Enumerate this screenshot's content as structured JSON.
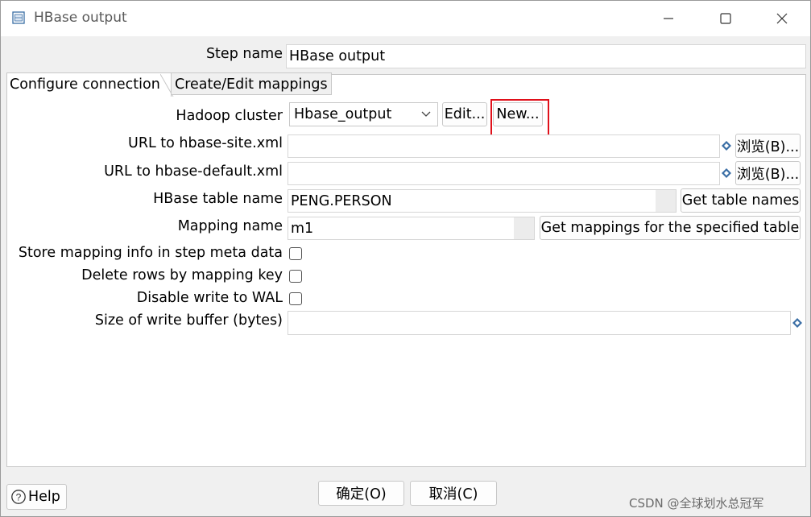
{
  "window": {
    "title": "HBase output",
    "icon": "hbase-step-icon",
    "controls": [
      "minimize-icon",
      "maximize-icon",
      "close-icon"
    ]
  },
  "step": {
    "label": "Step name",
    "value": "HBase output"
  },
  "tabs": [
    {
      "label": "Configure connection",
      "active": true
    },
    {
      "label": "Create/Edit mappings",
      "active": false
    }
  ],
  "connection": {
    "hadoop_cluster": {
      "label": "Hadoop cluster",
      "selected": "Hbase_output",
      "edit_label": "Edit...",
      "new_label": "New..."
    },
    "site_xml": {
      "label": "URL to hbase-site.xml",
      "value": "",
      "browse_label": "浏览(B)..."
    },
    "default_xml": {
      "label": "URL to hbase-default.xml",
      "value": "",
      "browse_label": "浏览(B)..."
    },
    "table_name": {
      "label": "HBase table name",
      "value": "PENG.PERSON",
      "button_label": "Get table names"
    },
    "mapping_name": {
      "label": "Mapping name",
      "value": "m1",
      "button_label": "Get mappings for the specified table"
    },
    "store_mapping": {
      "label": "Store mapping info in step meta data",
      "checked": false
    },
    "delete_rows": {
      "label": "Delete rows by mapping key",
      "checked": false
    },
    "disable_wal": {
      "label": "Disable write to WAL",
      "checked": false
    },
    "write_buffer": {
      "label": "Size of write buffer (bytes)",
      "value": ""
    }
  },
  "footer": {
    "help_label": "Help",
    "ok_label": "确定(O)",
    "cancel_label": "取消(C)"
  },
  "watermark": "CSDN @全球划水总冠军",
  "colors": {
    "highlight": "#e0101a",
    "variable_icon": "#3a6ea5"
  }
}
